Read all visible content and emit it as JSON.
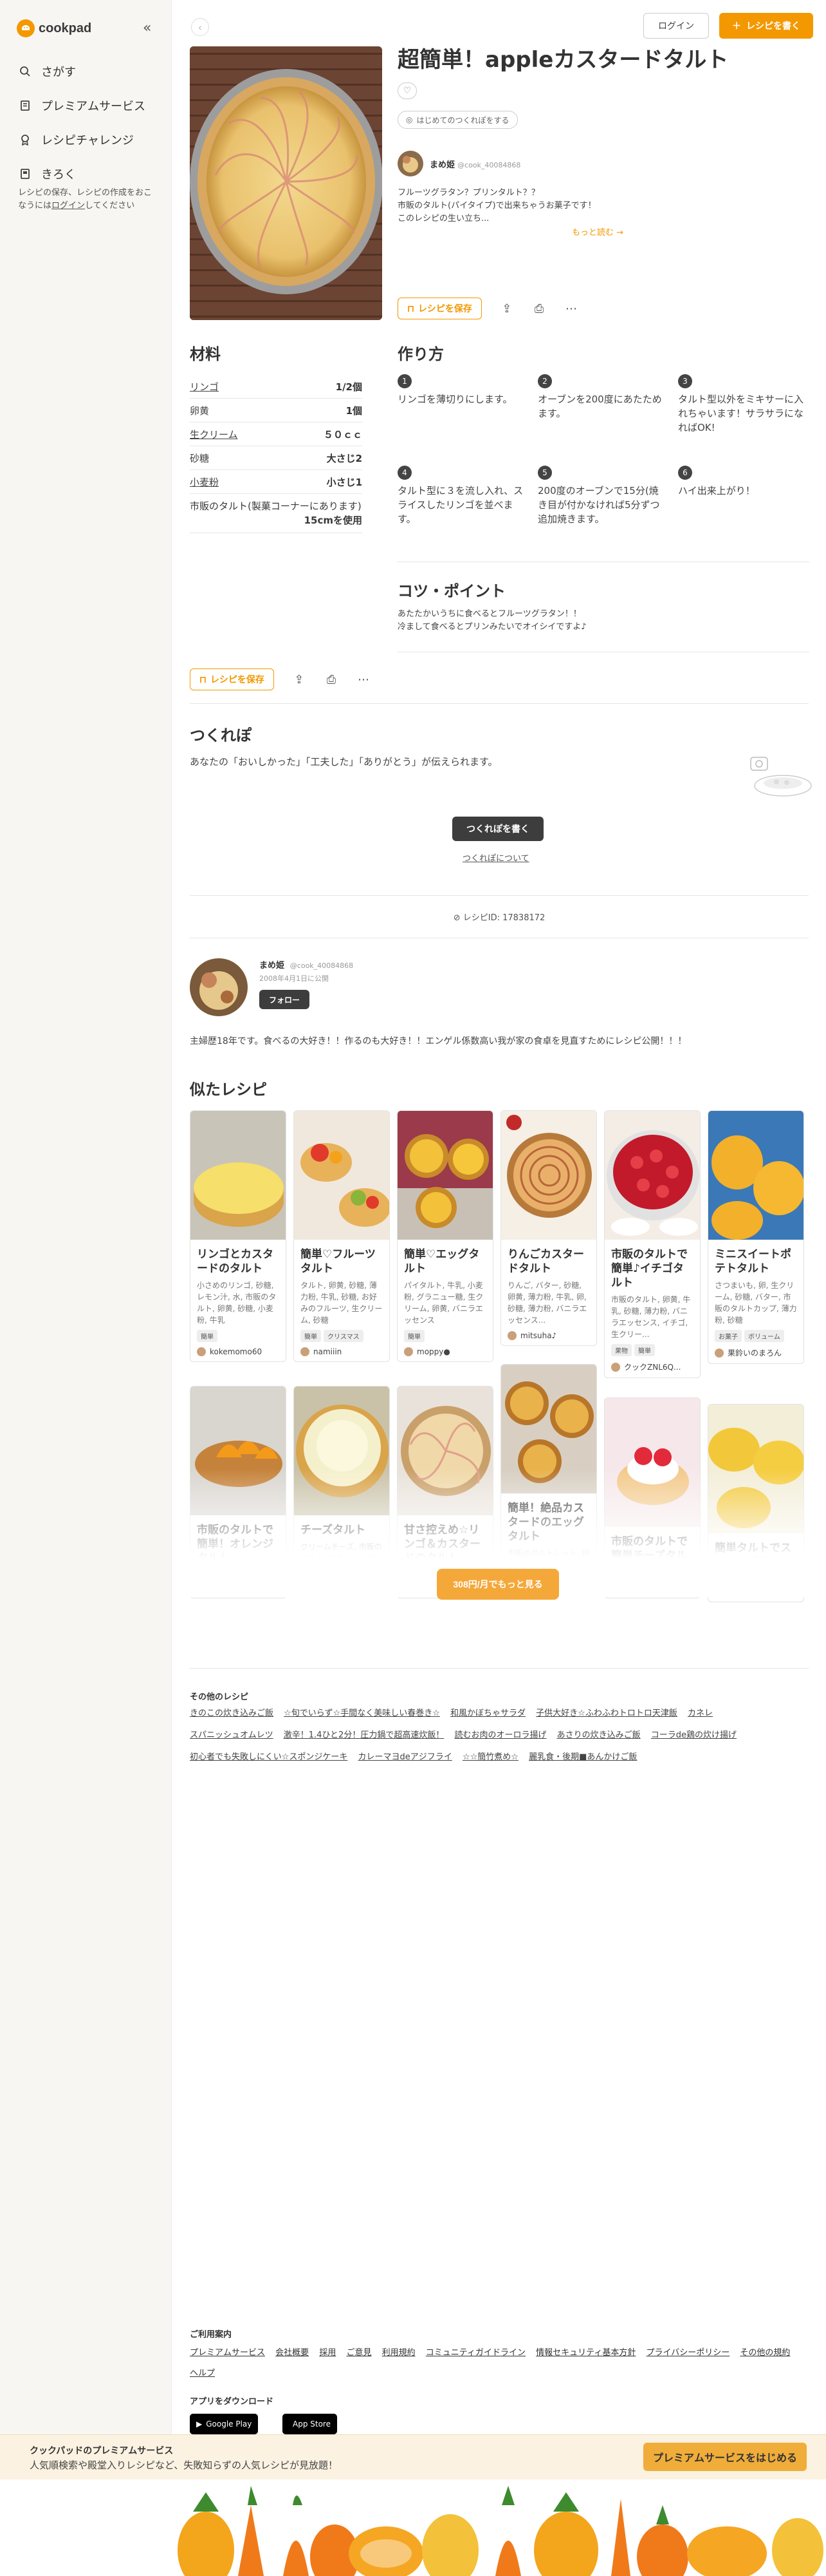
{
  "sidebar": {
    "logo": "cookpad",
    "items": [
      {
        "label": "さがす",
        "icon": "search-icon"
      },
      {
        "label": "プレミアムサービス",
        "icon": "premium-icon"
      },
      {
        "label": "レシピチャレンジ",
        "icon": "challenge-icon"
      },
      {
        "label": "きろく",
        "icon": "record-icon"
      }
    ],
    "note_pre": "レシピの保存、レシピの作成をおこなうには",
    "note_link": "ログイン",
    "note_post": "してください"
  },
  "header": {
    "login": "ログイン",
    "write": "レシピを書く"
  },
  "recipe": {
    "title": "超簡単！appleカスタードタルト",
    "first_tag": "はじめてのつくれぽをする",
    "author_name": "まめ姫",
    "author_id": "@cook_40084868",
    "description_lines": [
      "フルーツグラタン？プリンタルト？？",
      "市販のタルト(パイタイプ)で出来ちゃうお菓子です！",
      "このレシピの生い立ち..."
    ],
    "more": "もっと読む →",
    "save": "レシピを保存"
  },
  "ingredients": {
    "title": "材料",
    "items": [
      {
        "name": "リンゴ",
        "qty": "1/2個",
        "link": true
      },
      {
        "name": "卵黄",
        "qty": "1個",
        "link": false
      },
      {
        "name": "生クリーム",
        "qty": "５０ｃｃ",
        "link": true
      },
      {
        "name": "砂糖",
        "qty": "大さじ2",
        "link": false
      },
      {
        "name": "小麦粉",
        "qty": "小さじ1",
        "link": true
      }
    ],
    "tall_name": "市販のタルト(製菓コーナーにあります)",
    "tall_qty": "15cmを使用"
  },
  "steps": {
    "title": "作り方",
    "items": [
      {
        "num": "1",
        "text": "リンゴを薄切りにします。"
      },
      {
        "num": "2",
        "text": "オーブンを200度にあたためます。"
      },
      {
        "num": "3",
        "text": "タルト型以外をミキサーに入れちゃいます！サラサラになればOK!"
      },
      {
        "num": "4",
        "text": "タルト型に３を流し入れ、スライスしたリンゴを並べます。"
      },
      {
        "num": "5",
        "text": "200度のオーブンで15分(焼き目が付かなければ5分ずつ追加焼きます。"
      },
      {
        "num": "6",
        "text": "ハイ出来上がり！"
      }
    ]
  },
  "tips": {
    "title": "コツ・ポイント",
    "lines": [
      "あたたかいうちに食べるとフルーツグラタン！！",
      "冷まして食べるとプリンみたいでオイシイですよ♪"
    ]
  },
  "tsukurepo": {
    "title": "つくれぽ",
    "text": "あなたの「おいしかった」「工夫した」「ありがとう」が伝えられます。",
    "button": "つくれぽを書く",
    "about": "つくれぽについて"
  },
  "recipe_id": "レシピID: 17838172",
  "profile": {
    "name": "まめ姫",
    "id": "@cook_40084868",
    "date": "2008年4月1日に公開",
    "follow": "フォロー",
    "bio": "主婦歴18年です。食べるの大好き！！作るのも大好き！！エンゲル係数高い我が家の食卓を見直すためにレシピ公開！！！"
  },
  "similar": {
    "title": "似たレシピ",
    "cards": [
      {
        "title": "リンゴとカスタードのタルト",
        "ing": "小さめのリンゴ, 砂糖, レモン汁, 水, 市販のタルト, 卵黄, 砂糖, 小麦粉, 牛乳",
        "tags": [
          "簡単"
        ],
        "author": "kokemomo60",
        "img": "lemon"
      },
      {
        "title": "簡単♡フルーツタルト",
        "ing": "タルト, 卵黄, 砂糖, 薄力粉, 牛乳, 砂糖, お好みのフルーツ, 生クリーム, 砂糖",
        "tags": [
          "簡単",
          "クリスマス"
        ],
        "author": "namiiin",
        "img": "fruit"
      },
      {
        "title": "簡単♡エッグタルト",
        "ing": "パイタルト, 牛乳, 小麦粉, グラニュー糖, 生クリーム, 卵黄, バニラエッセンス",
        "tags": [
          "簡単"
        ],
        "author": "moppy●",
        "img": "egg"
      },
      {
        "title": "りんごカスタードタルト",
        "ing": "りんご, バター, 砂糖, 卵黄, 薄力粉, 牛乳, 卵, 砂糖, 薄力粉, バニラエッセンス...",
        "tags": [],
        "author": "mitsuha♪",
        "img": "apple"
      },
      {
        "title": "市販のタルトで簡単♪イチゴタルト",
        "ing": "市販のタルト, 卵黄, 牛乳, 砂糖, 薄力粉, バニラエッセンス, イチゴ, 生クリー...",
        "tags": [
          "果物",
          "簡単"
        ],
        "author": "クックZNL6Q...",
        "img": "strawberry"
      },
      {
        "title": "ミニスイートポテトタルト",
        "ing": "さつまいも, 卵, 生クリーム, 砂糖, バター, 市販のタルトカップ, 薄力粉, 砂糖",
        "tags": [
          "お菓子",
          "ボリューム"
        ],
        "author": "果鈴いのまろん",
        "img": "potato"
      },
      {
        "title": "市販のタルトで簡単！オレンジタルト",
        "ing": "市販のタルト, オレンジ, カスタード",
        "tags": [],
        "author": "",
        "img": "orange"
      },
      {
        "title": "チーズタルト",
        "ing": "クリームチーズ, 市販のタルト, グラニュー糖, 卵, レモン汁, 生クリーム",
        "tags": [],
        "author": "",
        "img": "cheese"
      },
      {
        "title": "甘さ控えめ☆リンゴ＆カスタードのタルト",
        "ing": "市販のタルト, りんご, カスタード",
        "tags": [],
        "author": "",
        "img": "apple2"
      },
      {
        "title": "簡単！絶品カスタードのエッグタルト",
        "ing": "市販のタルトレット, 卵黄, 砂糖, 牛乳",
        "tags": [],
        "author": "",
        "img": "egg2"
      },
      {
        "title": "市販のタルトで簡単チーズタルト",
        "ing": "クリームチーズ, 砂糖",
        "tags": [],
        "author": "",
        "img": "berry"
      },
      {
        "title": "簡単タルトでスイートポテト♪",
        "ing": "さつまいも, 市販のタルト, バター",
        "tags": [],
        "author": "",
        "img": "potato2"
      }
    ],
    "more_button": "308円/月でもっと見る"
  },
  "other": {
    "title": "その他のレシピ",
    "links": [
      "きのこの炊き込みご飯",
      "☆旬でいらず☆手間なく美味しい春巻き☆",
      "和風かぼちゃサラダ",
      "子供大好き☆ふわふわトロトロ天津飯",
      "カネレ",
      "スパニッシュオムレツ",
      "激辛！1.4ひと2分！圧力鍋で超高速炊飯！",
      "読むお肉のオーロラ揚げ",
      "あさりの炊き込みご飯",
      "コーラde鶏の炊け揚げ",
      "初心者でも失敗しにくい☆スポンジケーキ",
      "カレーマヨdeアジフライ",
      "☆☆簡竹煮め☆",
      "麗乳食・後期■あんかけご飯"
    ]
  },
  "footer": {
    "title": "ご利用案内",
    "links": [
      "プレミアムサービス",
      "会社概要",
      "採用",
      "ご意見",
      "利用規約",
      "コミュニティガイドライン",
      "情報セキュリティ基本方針",
      "プライバシーポリシー",
      "その他の規約",
      "ヘルプ"
    ],
    "app_title": "アプリをダウンロード",
    "google": "Google Play",
    "apple": "App Store"
  },
  "banner": {
    "title": "クックパッドのプレミアムサービス",
    "text": "人気順検索や殿堂入りレシピなど、失敗知らずの人気レシピが見放題！",
    "button": "プレミアムサービスをはじめる"
  },
  "colors": {
    "accent": "#f39800",
    "dark": "#3d3d3d"
  }
}
